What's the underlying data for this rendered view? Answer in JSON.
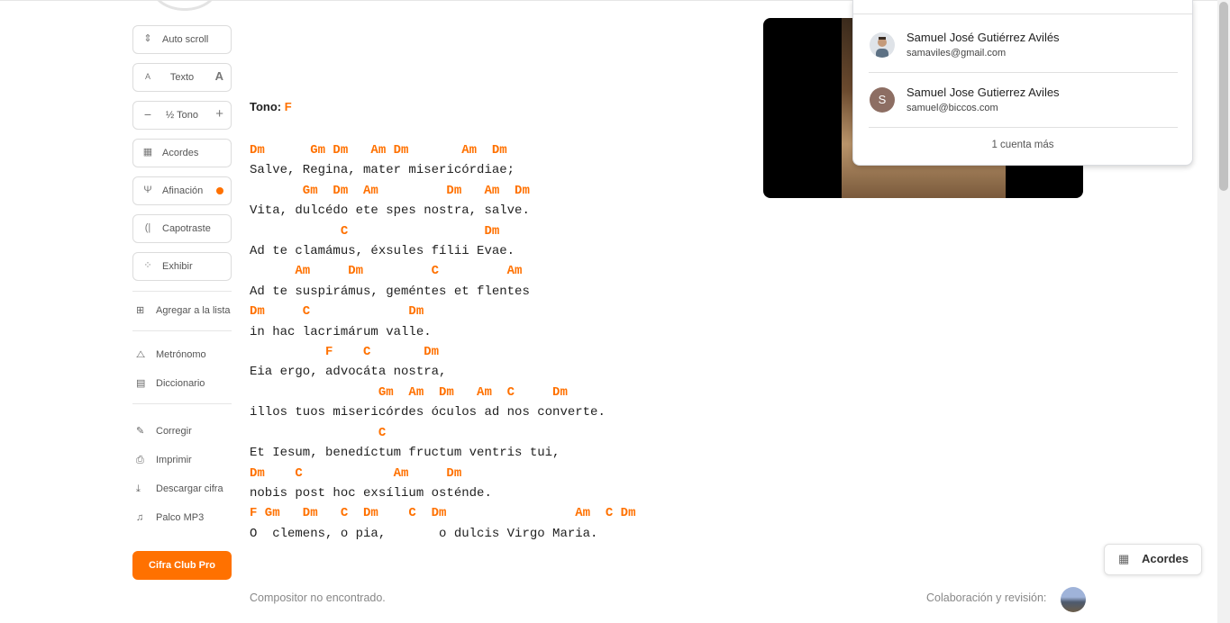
{
  "sidebar": {
    "auto_scroll": "Auto scroll",
    "texto": "Texto",
    "half_tone": "½ Tono",
    "acordes": "Acordes",
    "afinacion": "Afinación",
    "capotraste": "Capotraste",
    "exhibir": "Exhibir",
    "agregar_lista": "Agregar a la lista",
    "metronomo": "Metrónomo",
    "diccionario": "Diccionario",
    "corregir": "Corregir",
    "imprimir": "Imprimir",
    "descargar": "Descargar cifra",
    "palco": "Palco MP3",
    "pro": "Cifra Club Pro"
  },
  "tone": {
    "label": "Tono:",
    "key": "F"
  },
  "song": [
    {
      "type": "chord",
      "text": "Dm      Gm Dm   Am Dm       Am  Dm"
    },
    {
      "type": "lyric",
      "text": "Salve, Regina, mater misericórdiae;"
    },
    {
      "type": "chord",
      "text": "       Gm  Dm  Am         Dm   Am  Dm"
    },
    {
      "type": "lyric",
      "text": "Vita, dulcédo ete spes nostra, salve."
    },
    {
      "type": "chord",
      "text": "            C                  Dm"
    },
    {
      "type": "lyric",
      "text": "Ad te clamámus, éxsules fílii Evae."
    },
    {
      "type": "chord",
      "text": "      Am     Dm         C         Am"
    },
    {
      "type": "lyric",
      "text": "Ad te suspirámus, geméntes et flentes"
    },
    {
      "type": "chord",
      "text": "Dm     C             Dm"
    },
    {
      "type": "lyric",
      "text": "in hac lacrimárum valle."
    },
    {
      "type": "chord",
      "text": "          F    C       Dm"
    },
    {
      "type": "lyric",
      "text": "Eia ergo, advocáta nostra,"
    },
    {
      "type": "chord",
      "text": "                 Gm  Am  Dm   Am  C     Dm"
    },
    {
      "type": "lyric",
      "text": "illos tuos misericórdes óculos ad nos converte."
    },
    {
      "type": "chord",
      "text": "                 C"
    },
    {
      "type": "lyric",
      "text": "Et Iesum, benedíctum fructum ventris tui,"
    },
    {
      "type": "chord",
      "text": "Dm    C            Am     Dm"
    },
    {
      "type": "lyric",
      "text": "nobis post hoc exsílium osténde."
    },
    {
      "type": "chord",
      "text": "F Gm   Dm   C  Dm    C  Dm                 Am  C Dm"
    },
    {
      "type": "lyric",
      "text": "O  clemens, o pia,       o dulcis Virgo Maria."
    }
  ],
  "accounts": [
    {
      "name": "Samuel José Gutiérrez Avilés",
      "email": "samaviles@gmail.com",
      "initial": "",
      "color": "#dfe3e8"
    },
    {
      "name": "Samuel Jose Gutierrez Aviles",
      "email": "samuel@biccos.com",
      "initial": "S",
      "color": "#8d6e63"
    }
  ],
  "accounts_more": "1 cuenta más",
  "chip_label": "Acordes",
  "composer": "Compositor no encontrado.",
  "collab": "Colaboración y revisión:"
}
